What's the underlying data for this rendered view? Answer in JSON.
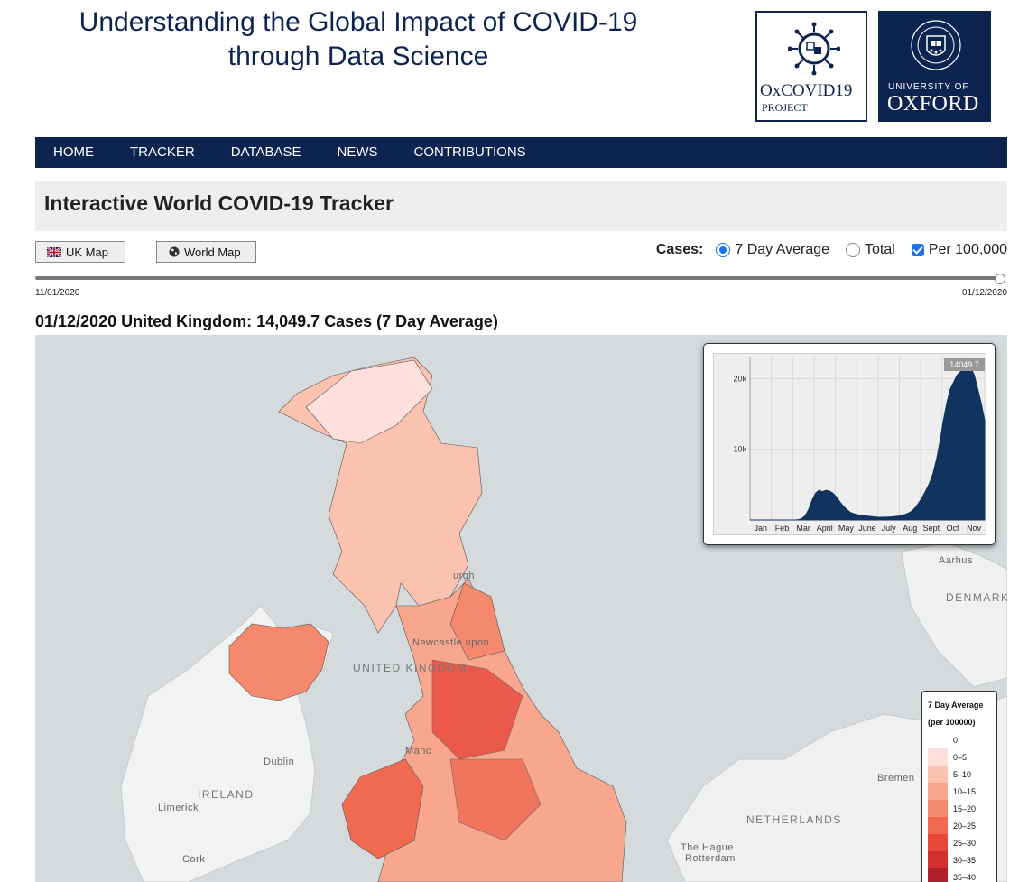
{
  "header": {
    "title_line1": "Understanding the Global Impact of COVID-19",
    "title_line2": "through Data Science",
    "logo_oxcovid_name": "OxCOVID19",
    "logo_oxcovid_sub": "PROJECT",
    "logo_uni_of": "UNIVERSITY OF",
    "logo_uni_name": "OXFORD"
  },
  "nav": {
    "items": [
      "HOME",
      "TRACKER",
      "DATABASE",
      "NEWS",
      "CONTRIBUTIONS"
    ]
  },
  "page": {
    "heading": "Interactive World COVID-19 Tracker"
  },
  "controls": {
    "uk_map_label": "UK Map",
    "world_map_label": "World Map",
    "cases_label": "Cases:",
    "option_7day": "7 Day Average",
    "option_total": "Total",
    "option_per100k": "Per 100,000",
    "selected": "7 Day Average",
    "per100k_checked": true
  },
  "slider": {
    "start_date": "11/01/2020",
    "end_date": "01/12/2020",
    "position": 1.0
  },
  "map": {
    "title": "01/12/2020 United Kingdom: 14,049.7 Cases (7 Day Average)",
    "labels": {
      "uk": "UNITED KINGDOM",
      "ireland": "IRELAND",
      "netherlands": "NETHERLANDS",
      "denmark": "DENMARK",
      "dublin": "Dublin",
      "limerick": "Limerick",
      "cork": "Cork",
      "hague": "The Hague",
      "rotterdam": "Rotterdam",
      "bremen": "Bremen",
      "aarhus": "Aarhus",
      "manchester": "Manc",
      "newcastle": "Newcastle upon",
      "edinburgh": "urgh"
    }
  },
  "chart_data": {
    "type": "area",
    "x": [
      "Jan",
      "Feb",
      "Mar",
      "April",
      "May",
      "June",
      "July",
      "Aug",
      "Sept",
      "Oct",
      "Nov"
    ],
    "tooltip_value": "14049.7",
    "y_ticks": [
      "10k",
      "20k"
    ],
    "ylim": [
      0,
      23000
    ],
    "series": [
      {
        "values": [
          0,
          0,
          0,
          0,
          0,
          0,
          0,
          0,
          0,
          0,
          0,
          0,
          0,
          0,
          50,
          200,
          600,
          1500,
          2800,
          3800,
          4200,
          4000,
          4200,
          4100,
          3800,
          3300,
          2600,
          2000,
          1500,
          1100,
          900,
          750,
          650,
          600,
          550,
          500,
          450,
          400,
          380,
          400,
          420,
          450,
          500,
          550,
          650,
          800,
          1000,
          1300,
          1800,
          2500,
          3300,
          4200,
          5200,
          6500,
          8500,
          11000,
          14000,
          16500,
          18500,
          19500,
          20500,
          21000,
          21500,
          22500,
          21500,
          20500,
          18500,
          16500,
          14049.7
        ]
      }
    ],
    "grid": true
  },
  "legend": {
    "title_line1": "7 Day Average",
    "title_line2": "(per 100000)",
    "items": [
      {
        "label": "0",
        "color": "#ffffff"
      },
      {
        "label": "0–5",
        "color": "#fde0dc"
      },
      {
        "label": "5–10",
        "color": "#fbc2b0"
      },
      {
        "label": "10–15",
        "color": "#f8a68e"
      },
      {
        "label": "15–20",
        "color": "#f5896e"
      },
      {
        "label": "20–25",
        "color": "#f06a52"
      },
      {
        "label": "25–30",
        "color": "#e8463a"
      },
      {
        "label": "30–35",
        "color": "#d32e2e"
      },
      {
        "label": "35–40",
        "color": "#b0202a"
      }
    ]
  },
  "colors": {
    "navy": "#0d2451",
    "area_fill": "#11335f",
    "accent_blue": "#1a73e8"
  }
}
